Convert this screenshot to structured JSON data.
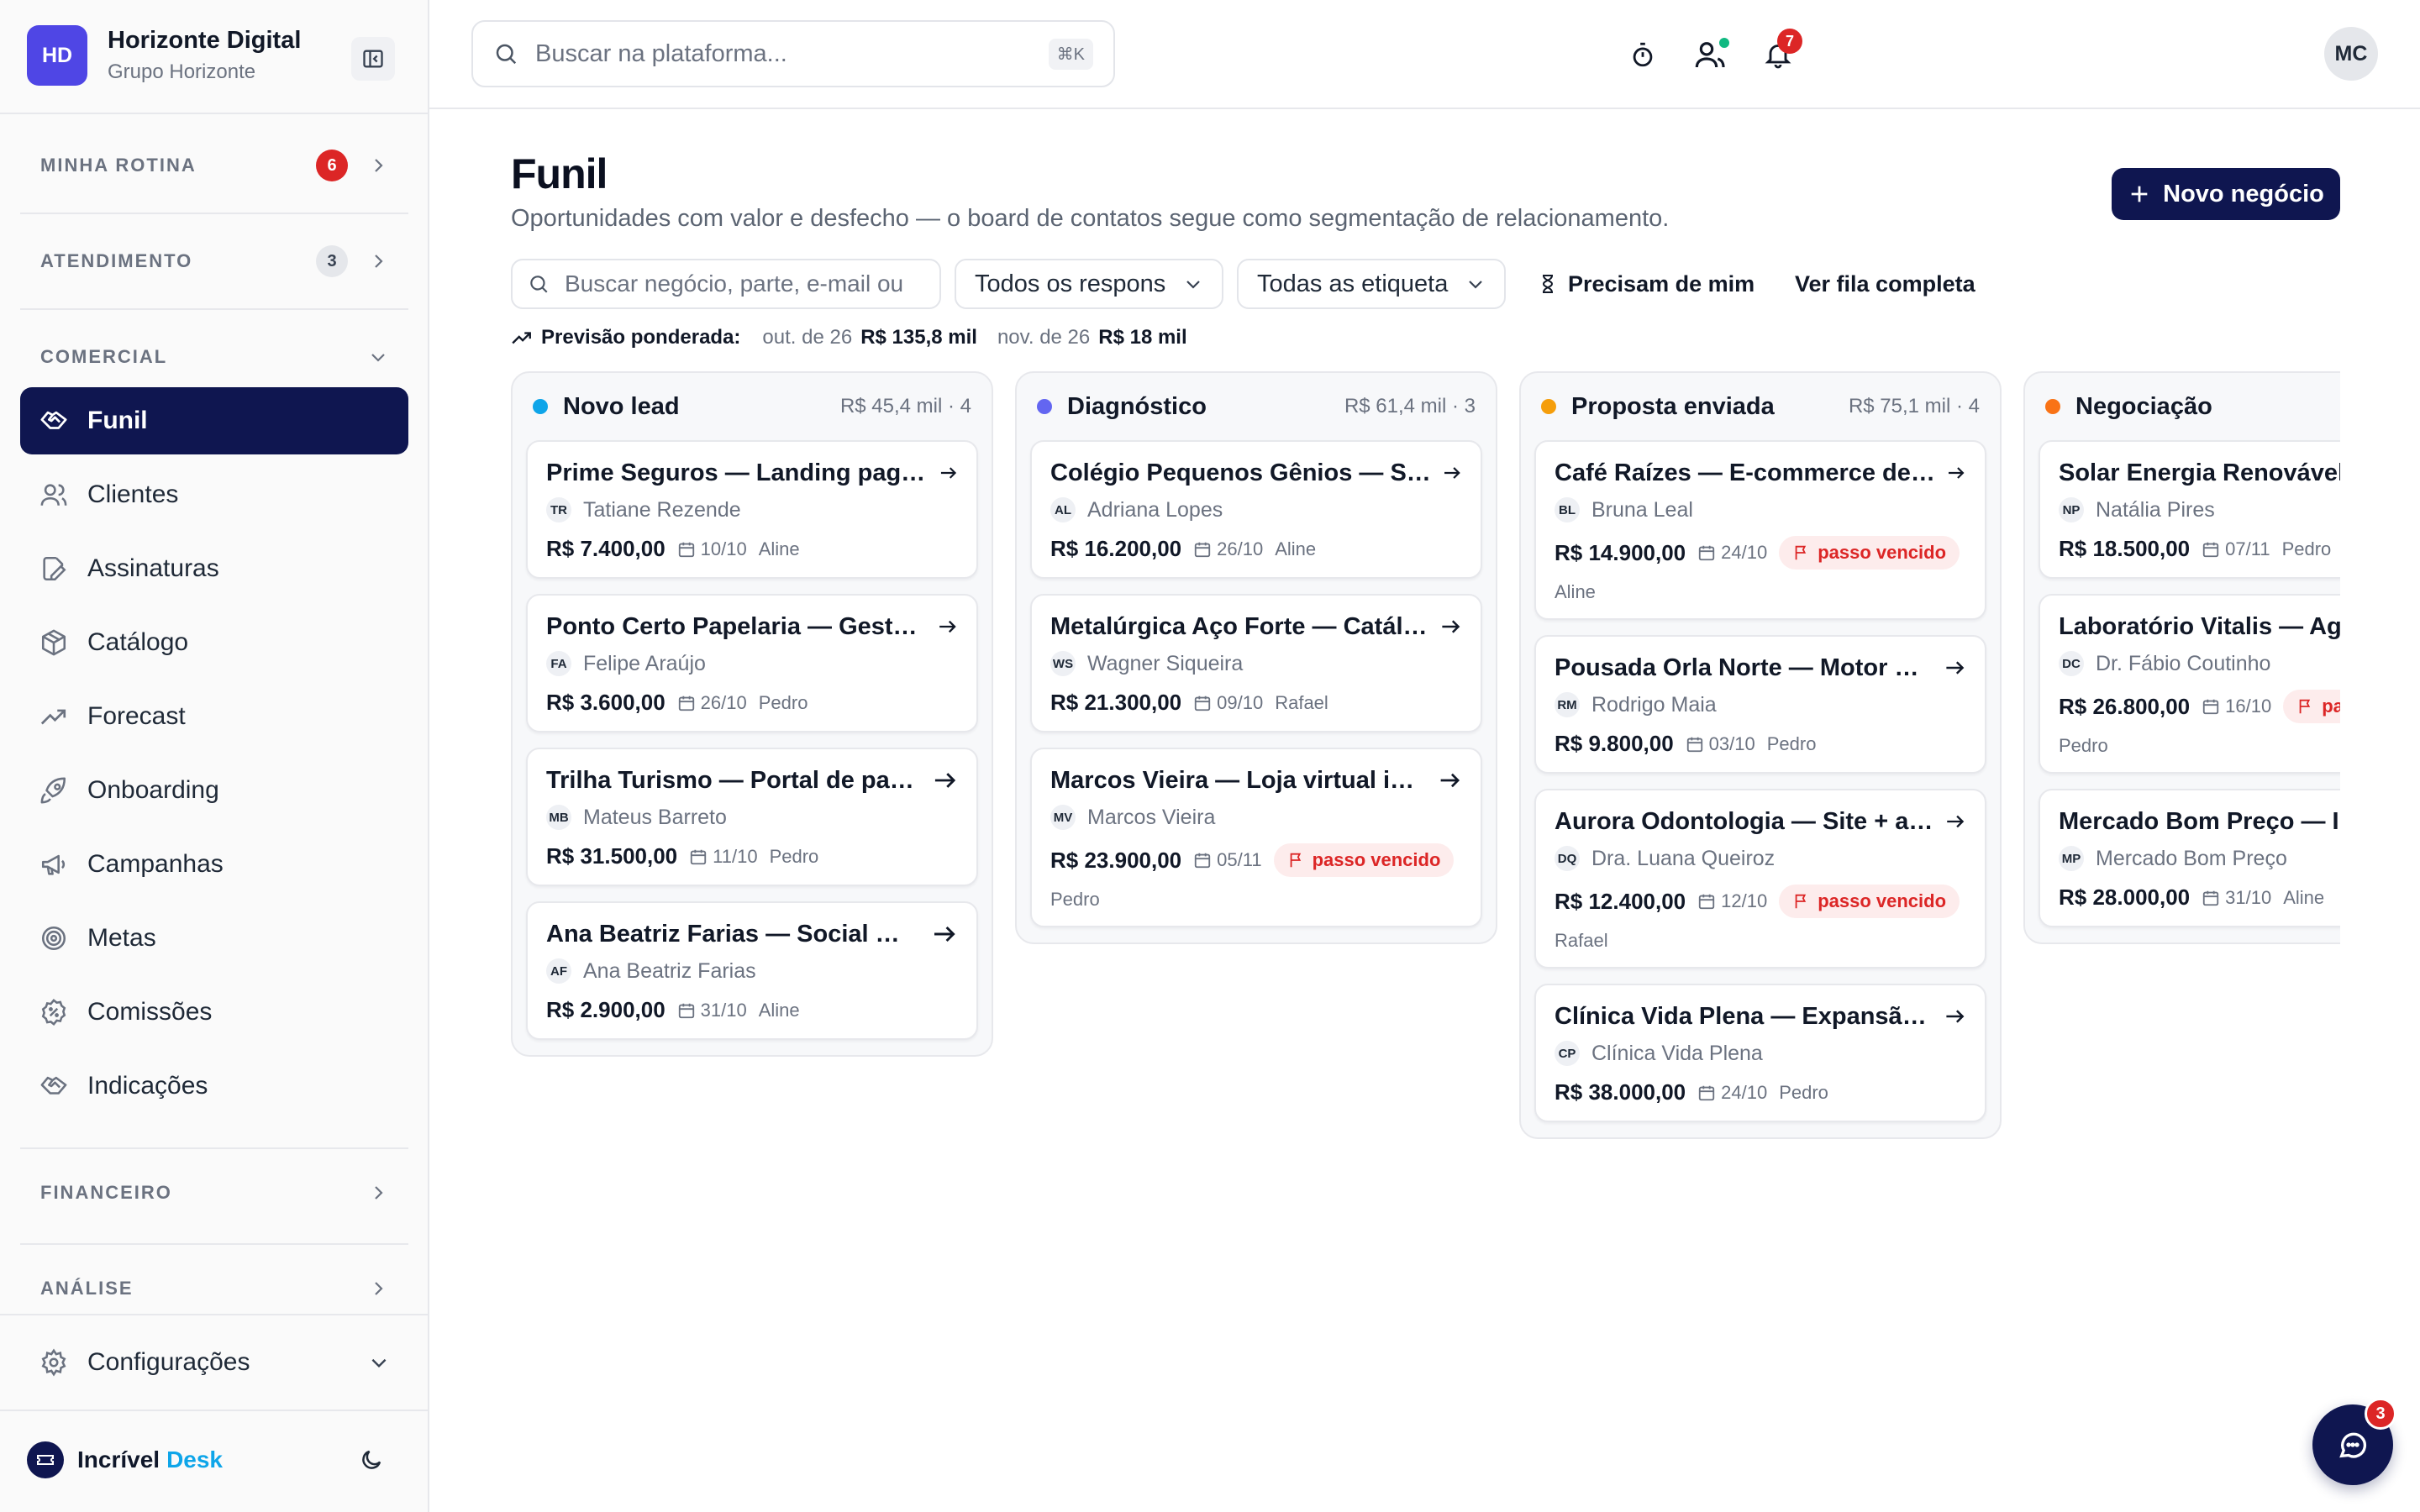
{
  "org": {
    "initials": "HD",
    "name": "Horizonte Digital",
    "group": "Grupo Horizonte"
  },
  "sidebar": {
    "sections": {
      "rotina": {
        "label": "MINHA ROTINA",
        "count": "6"
      },
      "atendimento": {
        "label": "ATENDIMENTO",
        "count": "3"
      },
      "comercial": {
        "label": "COMERCIAL"
      },
      "financeiro": {
        "label": "FINANCEIRO"
      },
      "analise": {
        "label": "ANÁLISE"
      }
    },
    "items": [
      {
        "label": "Funil",
        "icon": "handshake-icon",
        "active": true
      },
      {
        "label": "Clientes",
        "icon": "users-icon"
      },
      {
        "label": "Assinaturas",
        "icon": "signature-icon"
      },
      {
        "label": "Catálogo",
        "icon": "box-icon"
      },
      {
        "label": "Forecast",
        "icon": "trend-icon"
      },
      {
        "label": "Onboarding",
        "icon": "rocket-icon"
      },
      {
        "label": "Campanhas",
        "icon": "megaphone-icon"
      },
      {
        "label": "Metas",
        "icon": "target-icon"
      },
      {
        "label": "Comissões",
        "icon": "percent-badge-icon"
      },
      {
        "label": "Indicações",
        "icon": "handshake-icon"
      }
    ],
    "settings": "Configurações",
    "brand": {
      "name": "Incrível",
      "accent": "Desk"
    }
  },
  "topbar": {
    "search_placeholder": "Buscar na plataforma...",
    "shortcut": "⌘K",
    "notifications": "7",
    "user_initials": "MC"
  },
  "page": {
    "title": "Funil",
    "subtitle": "Oportunidades com valor e desfecho — o board de contatos segue como segmentação de relacionamento.",
    "new_button": "Novo negócio",
    "search_placeholder": "Buscar negócio, parte, e-mail ou",
    "owner_filter": "Todos os respons",
    "tag_filter": "Todas as etiqueta",
    "need_me": "Precisam de mim",
    "full_queue": "Ver fila completa",
    "forecast_label": "Previsão ponderada:",
    "forecast": [
      {
        "month": "out. de 26",
        "value": "R$ 135,8 mil"
      },
      {
        "month": "nov. de 26",
        "value": "R$ 18 mil"
      }
    ]
  },
  "colors": {
    "primary": "#0f1650",
    "danger": "#dc2626",
    "accent": "#0ea5e9"
  },
  "columns": [
    {
      "name": "Novo lead",
      "meta": "R$ 45,4 mil · 4",
      "color": "#0ea5e9",
      "cards": [
        {
          "title": "Prime Seguros — Landing page para campanha",
          "initials": "TR",
          "contact": "Tatiane Rezende",
          "value": "R$ 7.400,00",
          "date": "10/10",
          "owner": "Aline"
        },
        {
          "title": "Ponto Certo Papelaria — Gestão de estoque",
          "initials": "FA",
          "contact": "Felipe Araújo",
          "value": "R$ 3.600,00",
          "date": "26/10",
          "owner": "Pedro"
        },
        {
          "title": "Trilha Turismo — Portal de pacotes",
          "initials": "MB",
          "contact": "Mateus Barreto",
          "value": "R$ 31.500,00",
          "date": "11/10",
          "owner": "Pedro"
        },
        {
          "title": "Ana Beatriz Farias — Social media",
          "initials": "AF",
          "contact": "Ana Beatriz Farias",
          "value": "R$ 2.900,00",
          "date": "31/10",
          "owner": "Aline"
        }
      ]
    },
    {
      "name": "Diagnóstico",
      "meta": "R$ 61,4 mil · 3",
      "color": "#6366f1",
      "cards": [
        {
          "title": "Colégio Pequenos Gênios — Site institucional",
          "initials": "AL",
          "contact": "Adriana Lopes",
          "value": "R$ 16.200,00",
          "date": "26/10",
          "owner": "Aline"
        },
        {
          "title": "Metalúrgica Aço Forte — Catálogo digital",
          "initials": "WS",
          "contact": "Wagner Siqueira",
          "value": "R$ 21.300,00",
          "date": "09/10",
          "owner": "Rafael"
        },
        {
          "title": "Marcos Vieira — Loja virtual integrada",
          "initials": "MV",
          "contact": "Marcos Vieira",
          "value": "R$ 23.900,00",
          "date": "05/11",
          "overdue": "passo vencido",
          "owner": "Pedro"
        }
      ]
    },
    {
      "name": "Proposta enviada",
      "meta": "R$ 75,1 mil · 4",
      "color": "#f59e0b",
      "cards": [
        {
          "title": "Café Raízes — E-commerce de cafés especiais",
          "initials": "BL",
          "contact": "Bruna Leal",
          "value": "R$ 14.900,00",
          "date": "24/10",
          "overdue": "passo vencido",
          "owner": "Aline"
        },
        {
          "title": "Pousada Orla Norte — Motor de reservas",
          "initials": "RM",
          "contact": "Rodrigo Maia",
          "value": "R$ 9.800,00",
          "date": "03/10",
          "owner": "Pedro"
        },
        {
          "title": "Aurora Odontologia — Site + agendamento",
          "initials": "DQ",
          "contact": "Dra. Luana Queiroz",
          "value": "R$ 12.400,00",
          "date": "12/10",
          "overdue": "passo vencido",
          "owner": "Rafael"
        },
        {
          "title": "Clínica Vida Plena — Expansão do portal",
          "initials": "CP",
          "contact": "Clínica Vida Plena",
          "value": "R$ 38.000,00",
          "date": "24/10",
          "owner": "Pedro"
        }
      ]
    },
    {
      "name": "Negociação",
      "meta": "",
      "color": "#f97316",
      "cards": [
        {
          "title": "Solar Energia Renovável — Portal",
          "initials": "NP",
          "contact": "Natália Pires",
          "value": "R$ 18.500,00",
          "date": "07/11",
          "owner": "Pedro"
        },
        {
          "title": "Laboratório Vitalis — Agendamento",
          "initials": "DC",
          "contact": "Dr. Fábio Coutinho",
          "value": "R$ 26.800,00",
          "date": "16/10",
          "overdue": "passo vencido",
          "owner": "Pedro"
        },
        {
          "title": "Mercado Bom Preço — Integração",
          "initials": "MP",
          "contact": "Mercado Bom Preço",
          "value": "R$ 28.000,00",
          "date": "31/10",
          "owner": "Aline"
        }
      ]
    }
  ],
  "chat": {
    "count": "3"
  }
}
